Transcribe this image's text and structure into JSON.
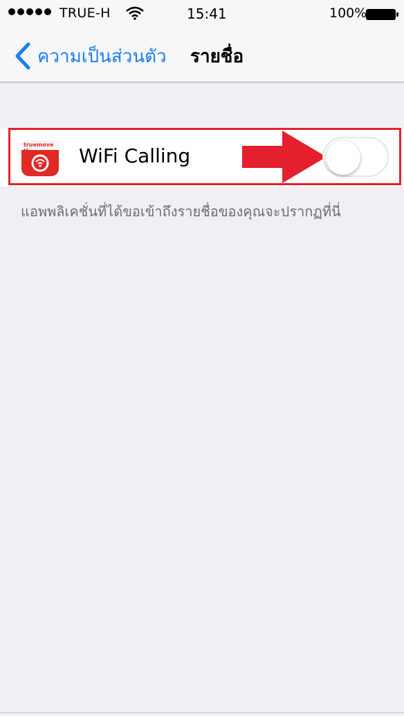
{
  "status_bar": {
    "carrier": "TRUE-H",
    "time": "15:41",
    "battery": "100%",
    "icons": [
      "signal-dots-icon",
      "wifi-icon",
      "battery-icon"
    ]
  },
  "nav": {
    "back_label": "ความเป็นส่วนตัว",
    "title": "รายชื่อ",
    "back_icon": "chevron-left-icon",
    "accent": "#1a7cf5"
  },
  "list": {
    "items": [
      {
        "app_name": "WiFi Calling",
        "icon": "truemove-wifi-calling-app-icon",
        "icon_brand_text": "truemove H",
        "toggle_on": false
      }
    ],
    "footer": "แอพพลิเคชั่นที่ได้ขอเข้าถึงรายชื่อของคุณจะปรากฏที่นี่"
  },
  "annotation": {
    "highlight_color": "#e5202e",
    "pointer": "red-arrow-icon"
  }
}
